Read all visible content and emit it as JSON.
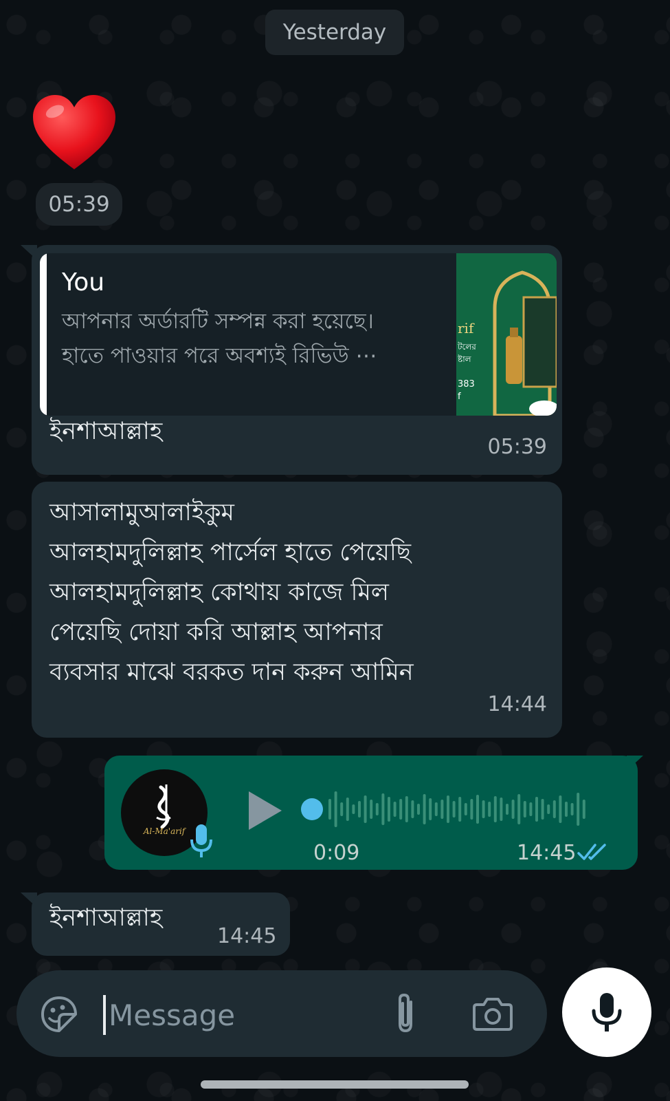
{
  "date_separator": "Yesterday",
  "reaction": {
    "emoji": "heart-emoji",
    "time": "05:39"
  },
  "messages": [
    {
      "direction": "incoming",
      "quoted": {
        "author": "You",
        "text": "আপনার অর্ডারটি সম্পন্ন করা হয়েছে।\nহাতে পাওয়ার পরে অবশ্যই রিভিউ ⋯"
      },
      "text": "ইনশাআল্লাহ",
      "time": "05:39"
    },
    {
      "direction": "incoming",
      "text": "আসালামুআলাইকুম\nআলহামদুলিল্লাহ পার্সেল হাতে পেয়েছি\nআলহামদুলিল্লাহ  কোথায় কাজে মিল\nপেয়েছি দোয়া করি আল্লাহ আপনার\nব্যবসার মাঝে বরকত দান করুন আমিন",
      "time": "14:44"
    },
    {
      "direction": "outgoing",
      "type": "voice",
      "avatar_label": "Al-Ma'arif",
      "duration": "0:09",
      "time": "14:45",
      "status": "read",
      "tick_color": "#53bdeb"
    },
    {
      "direction": "incoming",
      "text": "ইনশাআল্লাহ",
      "time": "14:45"
    }
  ],
  "composer": {
    "placeholder": "Message",
    "icons": [
      "emoji-icon",
      "attach-icon",
      "camera-icon",
      "mic-icon"
    ]
  },
  "colors": {
    "background": "#0b1014",
    "incoming_bubble": "#1f2c33",
    "outgoing_bubble": "#005c4b",
    "accent": "#53bdeb"
  }
}
